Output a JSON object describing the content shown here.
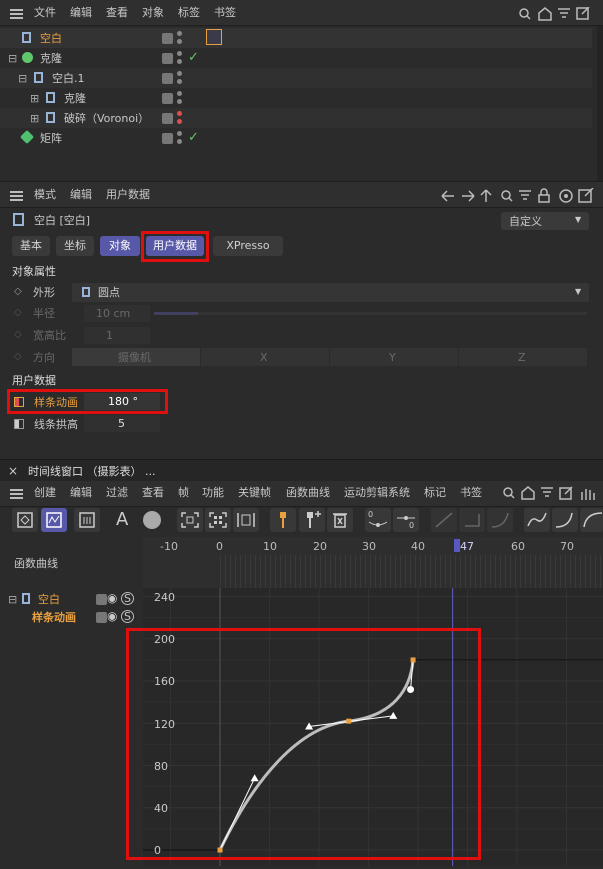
{
  "colors": {
    "accent": "#5858a8",
    "highlight": "#e8a040",
    "red_box": "#e01010",
    "green": "#5fc86b"
  },
  "om": {
    "menu": [
      "文件",
      "编辑",
      "查看",
      "对象",
      "标签",
      "书签"
    ],
    "objects": [
      {
        "name": "空白",
        "highlight": true
      },
      {
        "name": "克隆"
      },
      {
        "name": "空白.1"
      },
      {
        "name": "克隆"
      },
      {
        "name": "破碎（Voronoi）"
      },
      {
        "name": "矩阵"
      }
    ]
  },
  "attr": {
    "menu": [
      "模式",
      "编辑",
      "用户数据"
    ],
    "title": "空白 [空白]",
    "preset": "自定义",
    "tabs": [
      "基本",
      "坐标",
      "对象",
      "用户数据",
      "XPresso"
    ],
    "section_obj": "对象属性",
    "shape_label": "外形",
    "shape_value": "圆点",
    "radius_label": "半径",
    "radius_value": "10 cm",
    "aspect_label": "宽高比",
    "aspect_value": "1",
    "dir_label": "方向",
    "dir_values": [
      "摄像机",
      "X",
      "Y",
      "Z"
    ],
    "section_user": "用户数据",
    "spline_label": "样条动画",
    "spline_value": "180 °",
    "line_label": "线条拱高",
    "line_value": "5"
  },
  "timeline": {
    "tab_title": "时间线窗口 （摄影表） ...",
    "close": "×",
    "menu": [
      "创建",
      "编辑",
      "过滤",
      "查看",
      "帧",
      "功能",
      "关键帧",
      "函数曲线",
      "运动剪辑系统",
      "标记",
      "书签"
    ],
    "left_title": "函数曲线",
    "tree": [
      {
        "name": "空白"
      },
      {
        "name": "样条动画"
      }
    ],
    "x_ticks": [
      "-10",
      "0",
      "10",
      "20",
      "30",
      "40",
      "47",
      "60",
      "70"
    ],
    "current_frame": "47",
    "y_ticks": [
      "240",
      "200",
      "160",
      "120",
      "80",
      "40",
      "0"
    ]
  },
  "chart_data": {
    "type": "line",
    "x_range": [
      -10,
      75
    ],
    "y_range": [
      -5,
      250
    ],
    "keys": [
      {
        "x": 0,
        "y": 0
      },
      {
        "x": 26,
        "y": 122
      },
      {
        "x": 39,
        "y": 180
      }
    ],
    "current_frame": 47
  }
}
